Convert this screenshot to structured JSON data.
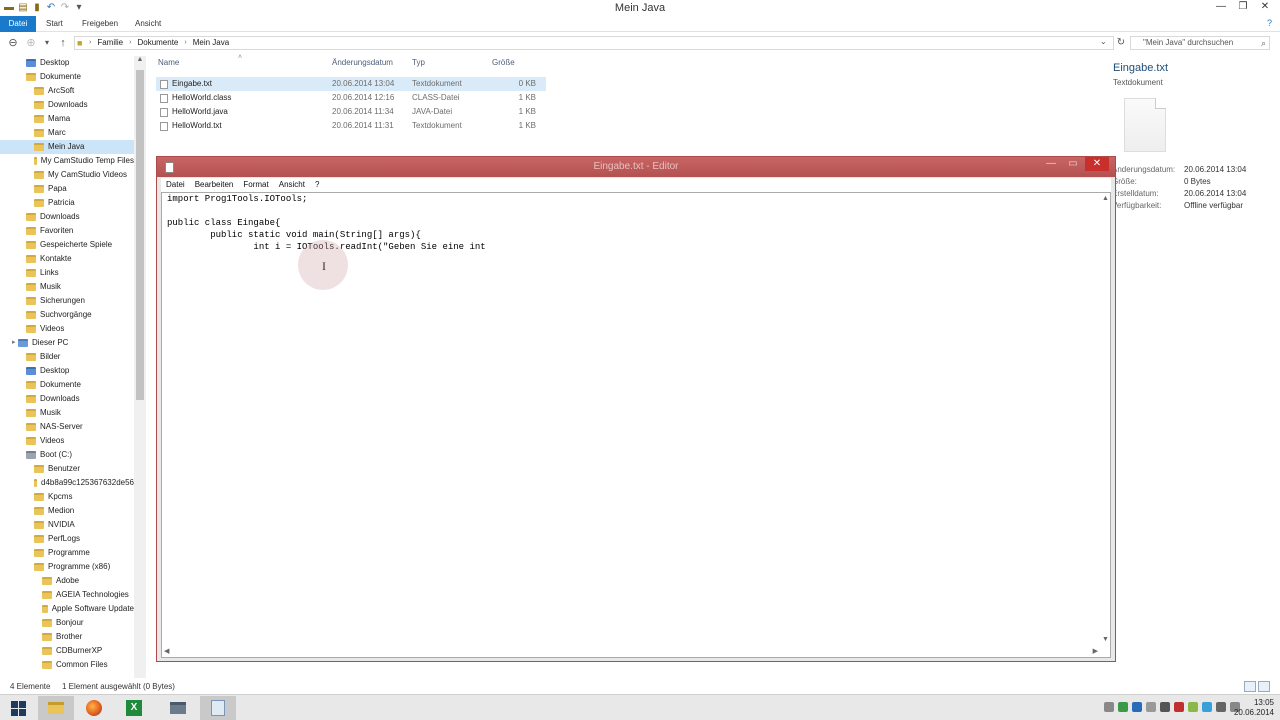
{
  "explorer": {
    "window_title": "Mein Java",
    "ribbon_tabs": [
      "Datei",
      "Start",
      "Freigeben",
      "Ansicht"
    ],
    "breadcrumbs": [
      "Familie",
      "Dokumente",
      "Mein Java"
    ],
    "search_placeholder": "\"Mein Java\" durchsuchen",
    "nav_items": [
      {
        "label": "Desktop",
        "indent": 1,
        "icon": "folder-blue-icon"
      },
      {
        "label": "Dokumente",
        "indent": 1,
        "icon": "folder-icon"
      },
      {
        "label": "ArcSoft",
        "indent": 2,
        "icon": "folder-icon"
      },
      {
        "label": "Downloads",
        "indent": 2,
        "icon": "folder-icon"
      },
      {
        "label": "Mama",
        "indent": 2,
        "icon": "folder-icon"
      },
      {
        "label": "Marc",
        "indent": 2,
        "icon": "folder-icon"
      },
      {
        "label": "Mein Java",
        "indent": 2,
        "icon": "folder-icon",
        "selected": true
      },
      {
        "label": "My CamStudio Temp Files",
        "indent": 2,
        "icon": "folder-icon"
      },
      {
        "label": "My CamStudio Videos",
        "indent": 2,
        "icon": "folder-icon"
      },
      {
        "label": "Papa",
        "indent": 2,
        "icon": "folder-icon"
      },
      {
        "label": "Patricia",
        "indent": 2,
        "icon": "folder-icon"
      },
      {
        "label": "Downloads",
        "indent": 1,
        "icon": "folder-icon"
      },
      {
        "label": "Favoriten",
        "indent": 1,
        "icon": "folder-icon"
      },
      {
        "label": "Gespeicherte Spiele",
        "indent": 1,
        "icon": "folder-icon"
      },
      {
        "label": "Kontakte",
        "indent": 1,
        "icon": "folder-icon"
      },
      {
        "label": "Links",
        "indent": 1,
        "icon": "folder-icon"
      },
      {
        "label": "Musik",
        "indent": 1,
        "icon": "folder-icon"
      },
      {
        "label": "Sicherungen",
        "indent": 1,
        "icon": "folder-icon"
      },
      {
        "label": "Suchvorgänge",
        "indent": 1,
        "icon": "folder-icon"
      },
      {
        "label": "Videos",
        "indent": 1,
        "icon": "folder-icon"
      },
      {
        "label": "Dieser PC",
        "indent": 0,
        "icon": "pc-icon"
      },
      {
        "label": "Bilder",
        "indent": 1,
        "icon": "folder-icon"
      },
      {
        "label": "Desktop",
        "indent": 1,
        "icon": "folder-blue-icon"
      },
      {
        "label": "Dokumente",
        "indent": 1,
        "icon": "folder-icon"
      },
      {
        "label": "Downloads",
        "indent": 1,
        "icon": "folder-icon"
      },
      {
        "label": "Musik",
        "indent": 1,
        "icon": "folder-icon"
      },
      {
        "label": "NAS-Server",
        "indent": 1,
        "icon": "folder-icon"
      },
      {
        "label": "Videos",
        "indent": 1,
        "icon": "folder-icon"
      },
      {
        "label": "Boot (C:)",
        "indent": 1,
        "icon": "drive-icon"
      },
      {
        "label": "Benutzer",
        "indent": 2,
        "icon": "folder-icon"
      },
      {
        "label": "d4b8a99c125367632de56",
        "indent": 2,
        "icon": "folder-icon"
      },
      {
        "label": "Kpcms",
        "indent": 2,
        "icon": "folder-icon"
      },
      {
        "label": "Medion",
        "indent": 2,
        "icon": "folder-icon"
      },
      {
        "label": "NVIDIA",
        "indent": 2,
        "icon": "folder-icon"
      },
      {
        "label": "PerfLogs",
        "indent": 2,
        "icon": "folder-icon"
      },
      {
        "label": "Programme",
        "indent": 2,
        "icon": "folder-icon"
      },
      {
        "label": "Programme (x86)",
        "indent": 2,
        "icon": "folder-icon"
      },
      {
        "label": "Adobe",
        "indent": 3,
        "icon": "folder-icon"
      },
      {
        "label": "AGEIA Technologies",
        "indent": 3,
        "icon": "folder-icon"
      },
      {
        "label": "Apple Software Update",
        "indent": 3,
        "icon": "folder-icon"
      },
      {
        "label": "Bonjour",
        "indent": 3,
        "icon": "folder-icon"
      },
      {
        "label": "Brother",
        "indent": 3,
        "icon": "folder-icon"
      },
      {
        "label": "CDBurnerXP",
        "indent": 3,
        "icon": "folder-icon"
      },
      {
        "label": "Common Files",
        "indent": 3,
        "icon": "folder-icon"
      }
    ],
    "columns": {
      "name": "Name",
      "date": "Änderungsdatum",
      "type": "Typ",
      "size": "Größe"
    },
    "files": [
      {
        "name": "Eingabe.txt",
        "date": "20.06.2014 13:04",
        "type": "Textdokument",
        "size": "0 KB",
        "selected": true
      },
      {
        "name": "HelloWorld.class",
        "date": "20.06.2014 12:16",
        "type": "CLASS-Datei",
        "size": "1 KB"
      },
      {
        "name": "HelloWorld.java",
        "date": "20.06.2014 11:34",
        "type": "JAVA-Datei",
        "size": "1 KB"
      },
      {
        "name": "HelloWorld.txt",
        "date": "20.06.2014 11:31",
        "type": "Textdokument",
        "size": "1 KB"
      }
    ],
    "details": {
      "title": "Eingabe.txt",
      "subtitle": "Textdokument",
      "rows": [
        {
          "key": "Änderungsdatum:",
          "value": "20.06.2014 13:04"
        },
        {
          "key": "Größe:",
          "value": "0 Bytes"
        },
        {
          "key": "Erstelldatum:",
          "value": "20.06.2014 13:04"
        },
        {
          "key": "Verfügbarkeit:",
          "value": "Offline verfügbar"
        }
      ]
    },
    "status": {
      "count": "4 Elemente",
      "selection": "1 Element ausgewählt (0 Bytes)"
    }
  },
  "notepad": {
    "title": "Eingabe.txt - Editor",
    "menu": [
      "Datei",
      "Bearbeiten",
      "Format",
      "Ansicht",
      "?"
    ],
    "content": "import Prog1Tools.IOTools;\n\npublic class Eingabe{\n        public static void main(String[] args){\n                int i = IOTools.readInt(\"Geben Sie eine int"
  },
  "taskbar": {
    "clock_time": "13:05",
    "clock_date": "20.06.2014"
  }
}
